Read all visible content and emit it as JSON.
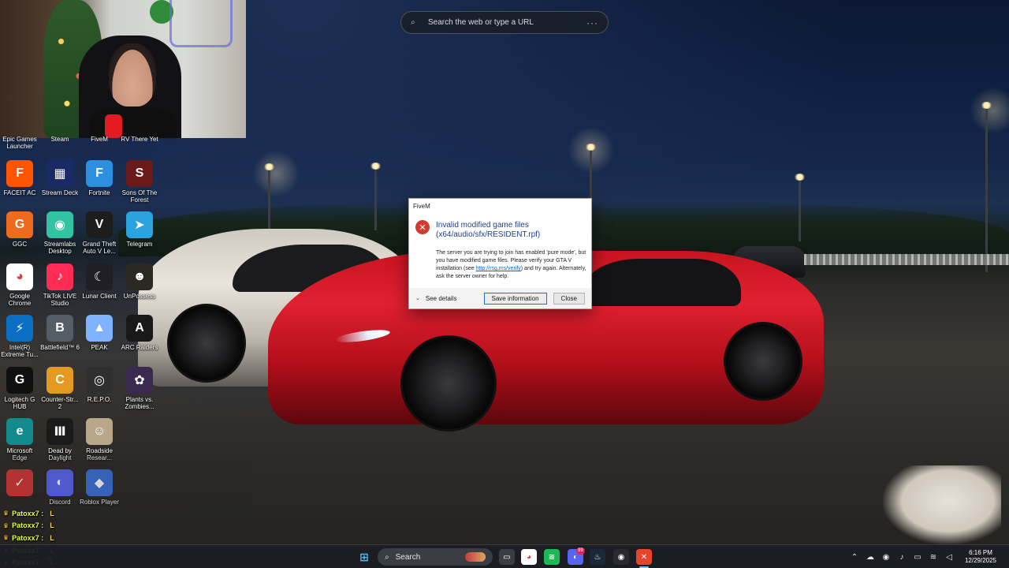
{
  "search": {
    "placeholder": "Search the web or type a URL",
    "more": "···"
  },
  "desktop": {
    "partial_labels": [
      "Epic Games Launcher",
      "Steam",
      "FiveM",
      "RV There Yet"
    ],
    "icons": [
      {
        "label": "FACEIT AC",
        "color": "#ff5500",
        "glyph": "F"
      },
      {
        "label": "Stream Deck",
        "color": "#1a2a66",
        "glyph": "▦"
      },
      {
        "label": "Fortnite",
        "color": "#2d8fe0",
        "glyph": "F"
      },
      {
        "label": "Sons Of The Forest",
        "color": "#6b1a1a",
        "glyph": "S"
      },
      {
        "label": "GGC",
        "color": "#ee6a1e",
        "glyph": "G"
      },
      {
        "label": "Streamlabs Desktop",
        "color": "#31c3a2",
        "glyph": "◉"
      },
      {
        "label": "Grand Theft Auto V Le...",
        "color": "#1d1d1d",
        "glyph": "V"
      },
      {
        "label": "Telegram",
        "color": "#2aa3df",
        "glyph": "➤"
      },
      {
        "label": "Google Chrome",
        "color": "#ffffff",
        "glyph": "◕"
      },
      {
        "label": "TikTok LIVE Studio",
        "color": "#fe2c55",
        "glyph": "♪"
      },
      {
        "label": "Lunar Client",
        "color": "#1f1f25",
        "glyph": "☾"
      },
      {
        "label": "UnPossess",
        "color": "#2a2a22",
        "glyph": "☻"
      },
      {
        "label": "Intel(R) Extreme Tu...",
        "color": "#0a6fc2",
        "glyph": "⚡"
      },
      {
        "label": "Battlefield™ 6",
        "color": "#555e66",
        "glyph": "B"
      },
      {
        "label": "PEAK",
        "color": "#7fb3ff",
        "glyph": "▲"
      },
      {
        "label": "ARC Raiders",
        "color": "#181818",
        "glyph": "A"
      },
      {
        "label": "Logitech G HUB",
        "color": "#101010",
        "glyph": "G"
      },
      {
        "label": "Counter-Str... 2",
        "color": "#e49a21",
        "glyph": "C"
      },
      {
        "label": "R.E.P.O.",
        "color": "#2f2f2f",
        "glyph": "◎"
      },
      {
        "label": "Plants vs. Zombies...",
        "color": "#3a2a50",
        "glyph": "✿"
      },
      {
        "label": "Microsoft Edge",
        "color": "#138a8c",
        "glyph": "e"
      },
      {
        "label": "Dead by Daylight",
        "color": "#1b1b1b",
        "glyph": "Ⅲ"
      },
      {
        "label": "Roadside Resear...",
        "color": "#b9a789",
        "glyph": "☺"
      },
      {
        "label": "",
        "color": "#2a2a2a",
        "glyph": ""
      },
      {
        "label": "",
        "color": "#d23535",
        "glyph": "✓"
      },
      {
        "label": "Discord",
        "color": "#5865f2",
        "glyph": "◐"
      },
      {
        "label": "Roblox Player",
        "color": "#3a6fd8",
        "glyph": "◆"
      }
    ]
  },
  "chat": {
    "lines": [
      {
        "name": "Patoxx7 :",
        "msg": "L"
      },
      {
        "name": "Patoxx7 :",
        "msg": "L"
      },
      {
        "name": "Patoxx7 :",
        "msg": "L"
      },
      {
        "name": "Patoxx7 :",
        "msg": "L"
      },
      {
        "name": "Patoxx7 :",
        "msg": "L"
      }
    ],
    "caption": "dy"
  },
  "dialog": {
    "title": "FiveM",
    "heading": "Invalid modified game files (x64/audio/sfx/RESIDENT.rpf)",
    "message_before": "The server you are trying to join has enabled 'pure mode', but you have modified game files. Please verify your GTA V installation (see ",
    "link": "http://rsg.ms/verify",
    "message_after": ") and try again. Alternately, ask the server owner for help.",
    "see_details": "See details",
    "save_button": "Save information",
    "close_button": "Close"
  },
  "taskbar": {
    "search_label": "Search",
    "time": "6:16 PM",
    "date": "12/29/2025",
    "apps": [
      {
        "name": "task-view",
        "color": "#3a3d44",
        "glyph": "▭"
      },
      {
        "name": "chrome",
        "color": "#ffffff",
        "glyph": "◕"
      },
      {
        "name": "spotify",
        "color": "#1db954",
        "glyph": "≋"
      },
      {
        "name": "discord",
        "color": "#5865f2",
        "glyph": "◐"
      },
      {
        "name": "steam",
        "color": "#1b2838",
        "glyph": "♨"
      },
      {
        "name": "obs",
        "color": "#2a2a2e",
        "glyph": "◉"
      },
      {
        "name": "fivem",
        "color": "#e8442c",
        "glyph": "✕"
      }
    ],
    "badge_discord": "99"
  }
}
